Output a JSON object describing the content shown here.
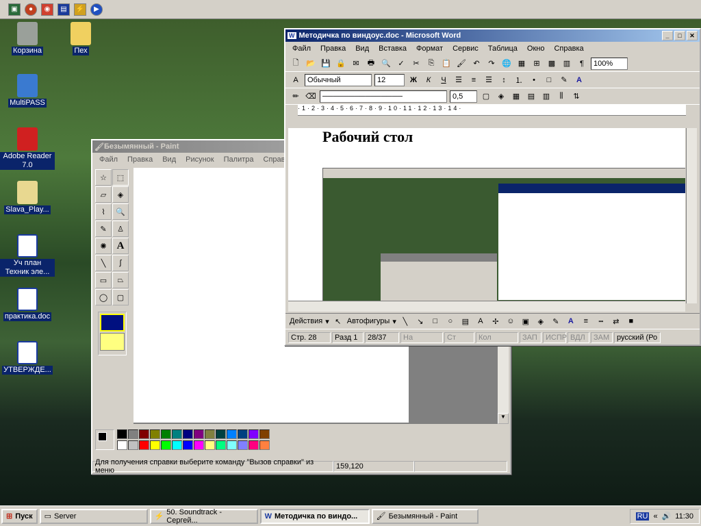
{
  "desktop_icons": [
    {
      "label": "Корзина",
      "icon": "recycle-bin-icon"
    },
    {
      "label": "Пех",
      "icon": "folder-icon"
    },
    {
      "label": "MultiPASS",
      "icon": "multipass-icon"
    },
    {
      "label": "Adobe Reader 7.0",
      "icon": "adobe-reader-icon"
    },
    {
      "label": "Slava_Play...",
      "icon": "playlist-icon"
    },
    {
      "label": "Уч план Техник эле...",
      "icon": "word-doc-icon"
    },
    {
      "label": "практика.doc",
      "icon": "word-doc-icon"
    },
    {
      "label": "УТВЕРЖДЕ...",
      "icon": "word-doc-icon"
    }
  ],
  "word": {
    "title": "Методичка по виндоус.doc - Microsoft Word",
    "menu": [
      "Файл",
      "Правка",
      "Вид",
      "Вставка",
      "Формат",
      "Сервис",
      "Таблица",
      "Окно",
      "Справка"
    ],
    "zoom": "100%",
    "style": "Обычный",
    "font_size": "12",
    "line_weight": "0,5",
    "doc_heading": "Рабочий стол",
    "draw_actions": "Действия",
    "autoshapes": "Автофигуры",
    "status": [
      "Стр. 28",
      "Разд 1",
      "28/37",
      "На",
      "Ст",
      "Кол",
      "ЗАП",
      "ИСПР",
      "ВДЛ",
      "ЗАМ",
      "русский (Ро"
    ]
  },
  "paint": {
    "title": "Безымянный - Paint",
    "menu": [
      "Файл",
      "Правка",
      "Вид",
      "Рисунок",
      "Палитра",
      "Справка"
    ],
    "status_text": "Для получения справки выберите команду \"Вызов справки\" из меню",
    "coords": "159,120",
    "palette": [
      "#000000",
      "#808080",
      "#800000",
      "#808000",
      "#008000",
      "#008080",
      "#000080",
      "#800080",
      "#808040",
      "#004040",
      "#0080ff",
      "#004080",
      "#8000ff",
      "#804000",
      "#ffffff",
      "#c0c0c0",
      "#ff0000",
      "#ffff00",
      "#00ff00",
      "#00ffff",
      "#0000ff",
      "#ff00ff",
      "#ffff80",
      "#00ff80",
      "#80ffff",
      "#8080ff",
      "#ff0080",
      "#ff8040"
    ]
  },
  "taskbar": {
    "start": "Пуск",
    "items": [
      "Server",
      "50. Soundtrack - Сергей...",
      "Методичка по виндо...",
      "Безымянный - Paint"
    ],
    "lang": "RU",
    "clock": "11:30"
  }
}
